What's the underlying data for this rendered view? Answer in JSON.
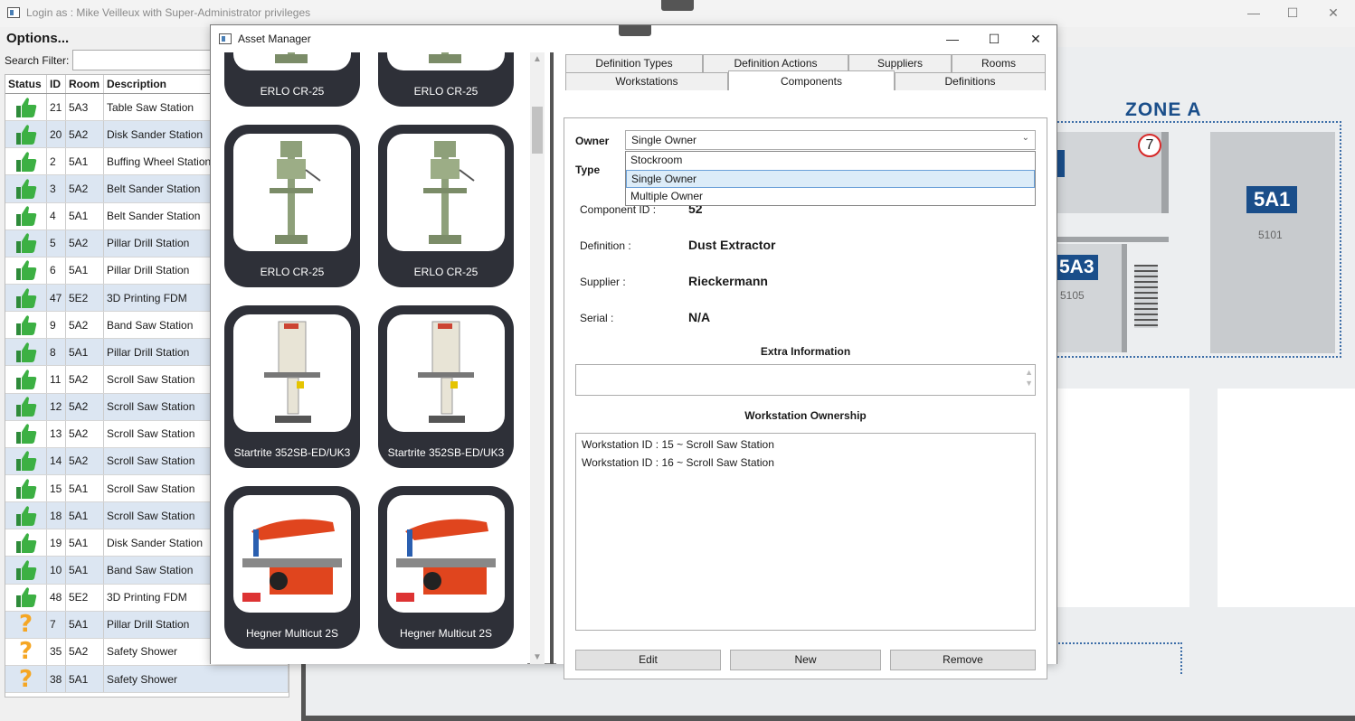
{
  "main_window": {
    "title": "Login as : Mike Veilleux with Super-Administrator privileges",
    "controls": {
      "minimize": "—",
      "maximize": "☐",
      "close": "✕"
    }
  },
  "left_panel": {
    "options_title": "Options...",
    "search_label": "Search Filter:",
    "search_value": "",
    "columns": [
      "Status",
      "ID",
      "Room",
      "Description"
    ],
    "rows": [
      {
        "status": "ok",
        "id": "21",
        "room": "5A3",
        "description": "Table Saw Station"
      },
      {
        "status": "ok",
        "id": "20",
        "room": "5A2",
        "description": "Disk Sander Station"
      },
      {
        "status": "ok",
        "id": "2",
        "room": "5A1",
        "description": "Buffing Wheel Station"
      },
      {
        "status": "ok",
        "id": "3",
        "room": "5A2",
        "description": "Belt Sander Station"
      },
      {
        "status": "ok",
        "id": "4",
        "room": "5A1",
        "description": "Belt Sander Station"
      },
      {
        "status": "ok",
        "id": "5",
        "room": "5A2",
        "description": "Pillar Drill Station"
      },
      {
        "status": "ok",
        "id": "6",
        "room": "5A1",
        "description": "Pillar Drill Station"
      },
      {
        "status": "ok",
        "id": "47",
        "room": "5E2",
        "description": "3D Printing FDM"
      },
      {
        "status": "ok",
        "id": "9",
        "room": "5A2",
        "description": "Band Saw Station"
      },
      {
        "status": "ok",
        "id": "8",
        "room": "5A1",
        "description": "Pillar Drill Station"
      },
      {
        "status": "ok",
        "id": "11",
        "room": "5A2",
        "description": "Scroll Saw Station"
      },
      {
        "status": "ok",
        "id": "12",
        "room": "5A2",
        "description": "Scroll Saw Station"
      },
      {
        "status": "ok",
        "id": "13",
        "room": "5A2",
        "description": "Scroll Saw Station"
      },
      {
        "status": "ok",
        "id": "14",
        "room": "5A2",
        "description": "Scroll Saw Station"
      },
      {
        "status": "ok",
        "id": "15",
        "room": "5A1",
        "description": "Scroll Saw Station"
      },
      {
        "status": "ok",
        "id": "18",
        "room": "5A1",
        "description": "Scroll Saw Station"
      },
      {
        "status": "ok",
        "id": "19",
        "room": "5A1",
        "description": "Disk Sander Station"
      },
      {
        "status": "ok",
        "id": "10",
        "room": "5A1",
        "description": "Band Saw Station"
      },
      {
        "status": "ok",
        "id": "48",
        "room": "5E2",
        "description": "3D Printing FDM"
      },
      {
        "status": "unknown",
        "id": "7",
        "room": "5A1",
        "description": "Pillar Drill Station"
      },
      {
        "status": "unknown",
        "id": "35",
        "room": "5A2",
        "description": "Safety Shower"
      },
      {
        "status": "unknown",
        "id": "38",
        "room": "5A1",
        "description": "Safety Shower"
      }
    ],
    "status_icons": {
      "ok": "thumbs-up-icon",
      "unknown": "question-mark-icon"
    },
    "colors": {
      "ok": "#3cb043",
      "unknown": "#f5a623",
      "alt_row": "#dce6f2"
    }
  },
  "map": {
    "zone_label": "ZONE A",
    "rooms": [
      {
        "label": "5A1",
        "number": "5101"
      },
      {
        "label": "5A3",
        "number": "5105"
      }
    ],
    "marker": "7",
    "accent": "#1a4e8a"
  },
  "dialog": {
    "title": "Asset Manager",
    "assets": [
      {
        "name": "ERLO CR-25",
        "kind": "drill"
      },
      {
        "name": "ERLO CR-25",
        "kind": "drill"
      },
      {
        "name": "ERLO CR-25",
        "kind": "drill"
      },
      {
        "name": "ERLO CR-25",
        "kind": "drill"
      },
      {
        "name": "Startrite 352SB-ED/UK3",
        "kind": "bandsaw"
      },
      {
        "name": "Startrite 352SB-ED/UK3",
        "kind": "bandsaw"
      },
      {
        "name": "Hegner Multicut 2S",
        "kind": "scrollsaw"
      },
      {
        "name": "Hegner Multicut 2S",
        "kind": "scrollsaw"
      }
    ],
    "tabs_row1": [
      "Definition Types",
      "Definition Actions",
      "Suppliers",
      "Rooms"
    ],
    "tabs_row2": [
      "Workstations",
      "Components",
      "Definitions"
    ],
    "active_tab": "Components",
    "form": {
      "owner_label": "Owner",
      "owner_value": "Single Owner",
      "owner_options": [
        "Stockroom",
        "Single Owner",
        "Multiple Owner"
      ],
      "type_label": "Type",
      "component_id_label": "Component ID :",
      "component_id_value": "52",
      "definition_label": "Definition :",
      "definition_value": "Dust Extractor",
      "supplier_label": "Supplier :",
      "supplier_value": "Rieckermann",
      "serial_label": "Serial :",
      "serial_value": "N/A",
      "extra_info_title": "Extra Information",
      "extra_info_value": "",
      "ownership_title": "Workstation Ownership",
      "ownership_items": [
        "Workstation ID : 15 ~ Scroll Saw Station",
        "Workstation ID : 16 ~ Scroll Saw Station"
      ]
    },
    "buttons": {
      "edit": "Edit",
      "new": "New",
      "remove": "Remove"
    }
  }
}
